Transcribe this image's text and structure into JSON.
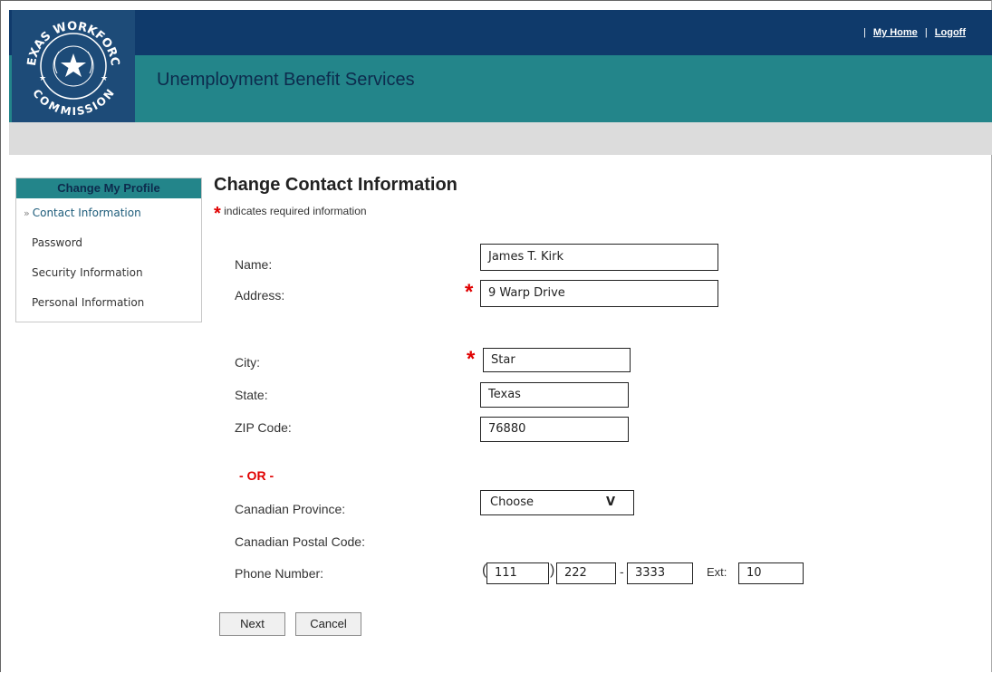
{
  "header": {
    "app_title": "Unemployment Benefit Services",
    "logo_top_text": "TEXAS WORKFORCE",
    "logo_bottom_text": "COMMISSION",
    "links": [
      "My Home",
      "Logoff"
    ]
  },
  "sidebar": {
    "title": "Change My Profile",
    "items": [
      {
        "label": "Contact Information"
      },
      {
        "label": "Password"
      },
      {
        "label": "Security Information"
      },
      {
        "label": "Personal Information"
      }
    ]
  },
  "main": {
    "title": "Change Contact Information",
    "required_note": "indicates required information"
  },
  "form": {
    "name_label": "Name:",
    "name_value": "James T. Kirk",
    "address_label": "Address:",
    "address_value": "9 Warp Drive",
    "city_label": "City:",
    "city_value": "Star",
    "state_label": "State:",
    "state_value": "Texas",
    "zip_label": "ZIP Code:",
    "zip_value": "76880",
    "or_text": "- OR -",
    "province_label": "Canadian Province:",
    "province_value": "Choose",
    "province_chevron": "V",
    "postal_label": "Canadian Postal Code:",
    "phone_label": "Phone Number:",
    "phone_area": "111",
    "phone_prefix": "222",
    "phone_line": "3333",
    "ext_label": "Ext:",
    "ext_value": "10",
    "next_label": "Next",
    "cancel_label": "Cancel"
  },
  "colors": {
    "header_dark": "#0f3a6b",
    "header_teal": "#23858a",
    "required_red": "#e00000"
  }
}
